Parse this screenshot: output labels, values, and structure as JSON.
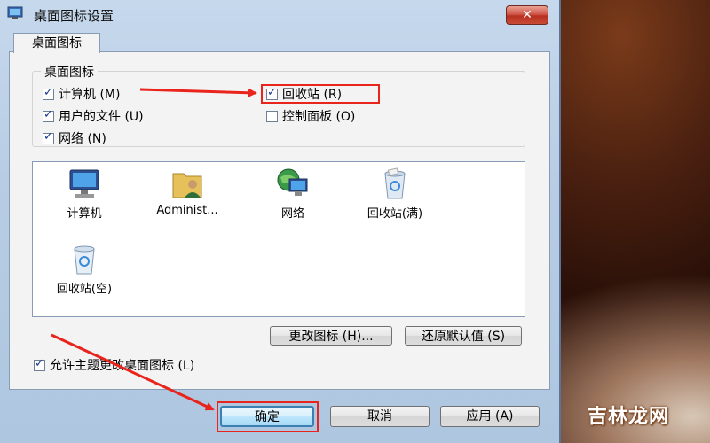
{
  "window": {
    "title": "桌面图标设置",
    "close_label": "✕"
  },
  "tabs": [
    {
      "label": "桌面图标"
    }
  ],
  "group": {
    "legend": "桌面图标",
    "checkboxes": [
      {
        "label": "计算机 (M)",
        "checked": true
      },
      {
        "label": "回收站 (R)",
        "checked": true
      },
      {
        "label": "用户的文件 (U)",
        "checked": true
      },
      {
        "label": "控制面板 (O)",
        "checked": false
      },
      {
        "label": "网络 (N)",
        "checked": true
      }
    ]
  },
  "icons": [
    {
      "label": "计算机",
      "icon": "computer-icon"
    },
    {
      "label": "Administ...",
      "icon": "user-folder-icon"
    },
    {
      "label": "网络",
      "icon": "network-icon"
    },
    {
      "label": "回收站(满)",
      "icon": "recycle-bin-full-icon"
    },
    {
      "label": "回收站(空)",
      "icon": "recycle-bin-empty-icon"
    }
  ],
  "buttons": {
    "change_icon": "更改图标 (H)...",
    "restore_default": "还原默认值 (S)",
    "ok": "确定",
    "cancel": "取消",
    "apply": "应用 (A)"
  },
  "allow_themes": {
    "label": "允许主题更改桌面图标 (L)",
    "checked": true
  },
  "watermark": "吉林龙网",
  "colors": {
    "annotation_red": "#e8241c",
    "primary_border": "#3c7fb1"
  }
}
